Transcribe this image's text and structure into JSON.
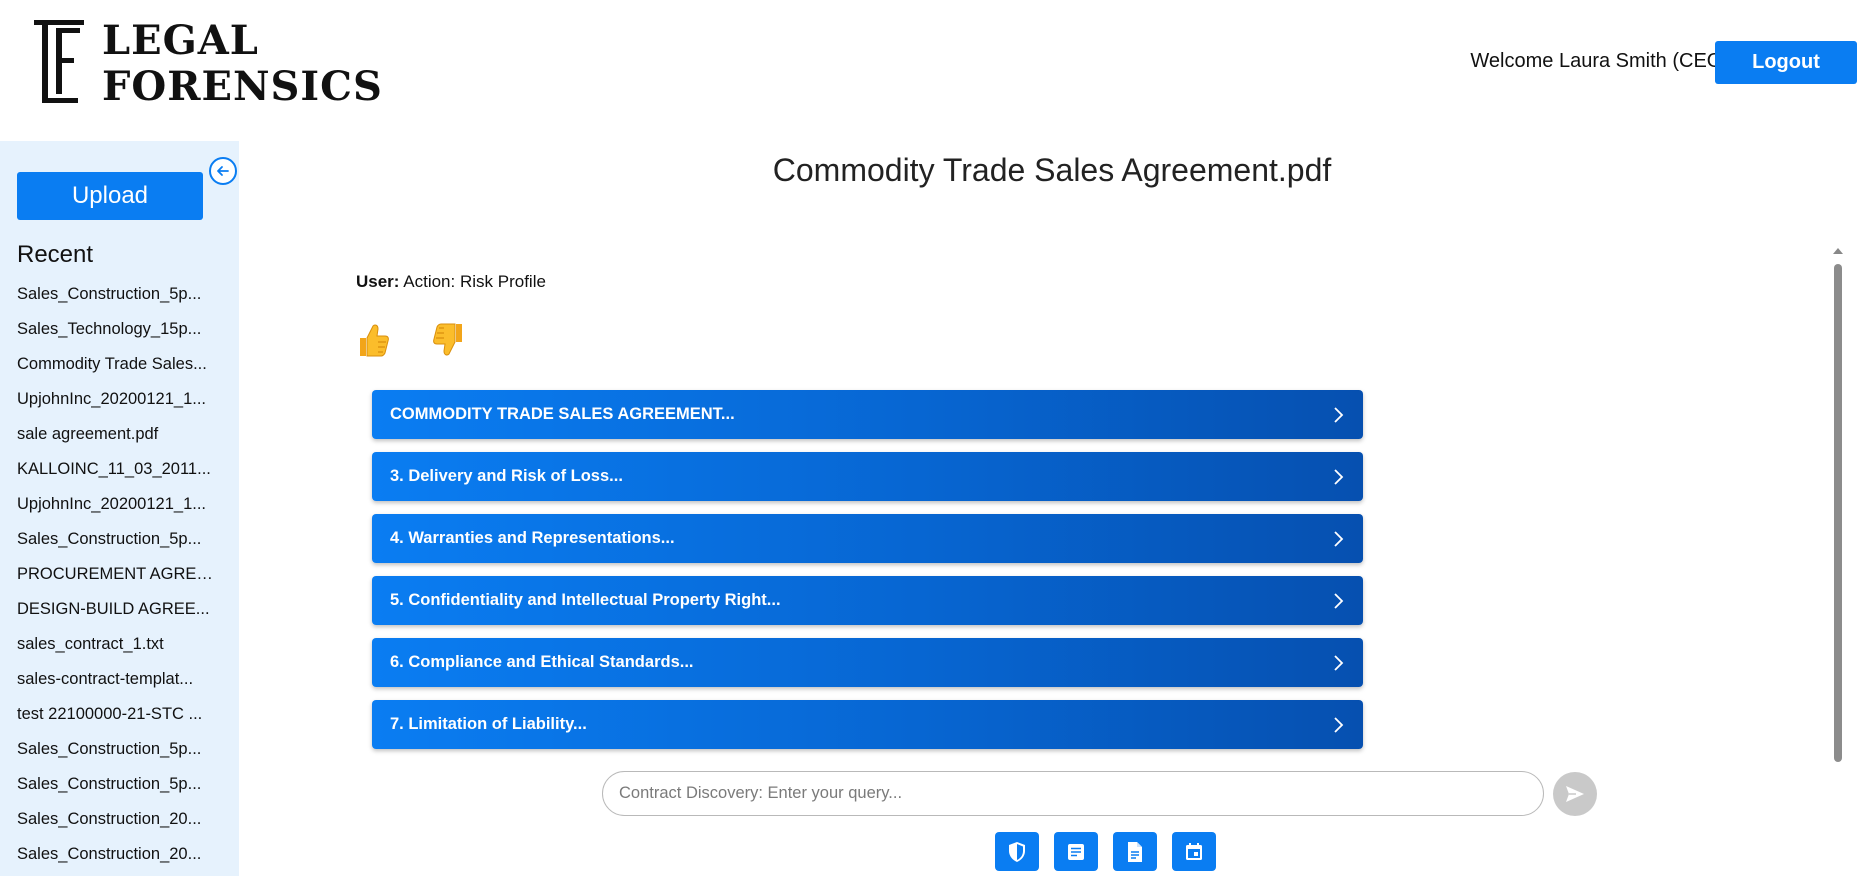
{
  "header": {
    "logo": {
      "line1": "LEGAL",
      "line2": "FORENSICS"
    },
    "welcome_text": "Welcome Laura Smith (CEO)",
    "logout_label": "Logout"
  },
  "sidebar": {
    "upload_label": "Upload",
    "recent_title": "Recent",
    "recent_items": [
      "Sales_Construction_5p...",
      "Sales_Technology_15p...",
      "Commodity Trade Sales...",
      "UpjohnInc_20200121_1...",
      "sale agreement.pdf",
      "KALLOINC_11_03_2011...",
      "UpjohnInc_20200121_1...",
      "Sales_Construction_5p...",
      "PROCUREMENT AGREE...",
      "DESIGN-BUILD AGREE...",
      "sales_contract_1.txt",
      "sales-contract-templat...",
      "test 22100000-21-STC ...",
      "Sales_Construction_5p...",
      "Sales_Construction_5p...",
      "Sales_Construction_20...",
      "Sales_Construction_20..."
    ]
  },
  "main": {
    "document_title": "Commodity Trade Sales Agreement.pdf",
    "user_message": {
      "prefix": "User:",
      "text": "Action: Risk Profile"
    },
    "reactions": [
      "thumbs-up-icon",
      "thumbs-down-icon"
    ],
    "sections": [
      "COMMODITY TRADE SALES AGREEMENT...",
      "3. Delivery and Risk of Loss...",
      "4. Warranties and Representations...",
      "5. Confidentiality and Intellectual Property Right...",
      "6. Compliance and Ethical Standards...",
      "7. Limitation of Liability..."
    ],
    "query": {
      "placeholder": "Contract Discovery: Enter your query...",
      "value": ""
    },
    "tools": [
      "shield-icon",
      "summary-icon",
      "document-icon",
      "calendar-icon"
    ]
  },
  "colors": {
    "accent": "#0a7df2",
    "sidebar_bg": "#e6f2fd",
    "send_disabled": "#c9c9c9"
  }
}
